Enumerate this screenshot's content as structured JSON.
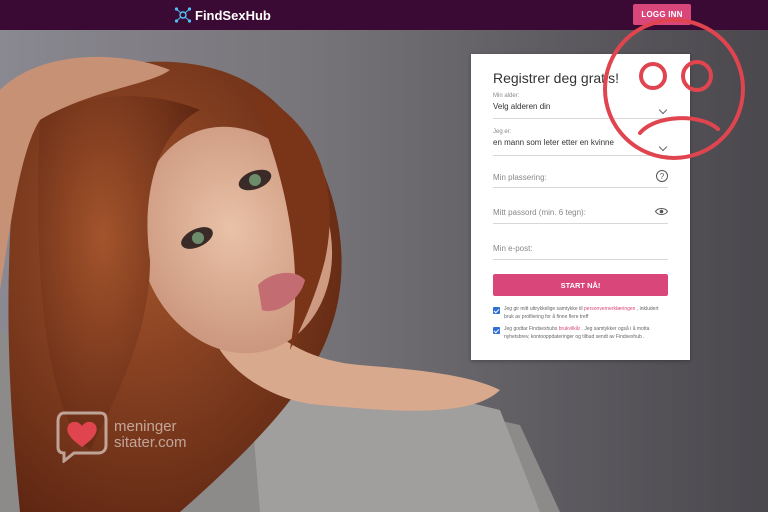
{
  "header": {
    "logo_text": "FindSexHub",
    "logo_icon": "network-icon",
    "login_label": "LOGG INN"
  },
  "form": {
    "title": "Registrer deg gratis!",
    "age": {
      "label": "Min alder:",
      "value": "Velg alderen din"
    },
    "gender": {
      "label": "Jeg er:",
      "value": "en mann som leter etter en kvinne"
    },
    "location_placeholder": "Min plassering:",
    "password_placeholder": "Mitt passord (min. 6 tegn):",
    "email_placeholder": "Min e-post:",
    "submit_label": "START NÅ!",
    "consent1": {
      "text_a": "Jeg gir mitt uttrykkelige samtykke til ",
      "link": "personvernerklæringen",
      "text_b": " , inkludert bruk av profilering for å finne flere treff"
    },
    "consent2": {
      "text_a": "Jeg godtar Findsexhubs ",
      "link": "brukvilkår",
      "text_b": " . Jeg samtykker også i å motta nyhetsbrev, kontooppdateringer og tilbud sendt av Findsexhub ."
    }
  },
  "watermark": {
    "line1": "meninger",
    "line2": "sitater.com"
  },
  "colors": {
    "topbar": "#3a0a34",
    "accent": "#d9467a",
    "sad_face": "#e0454f",
    "checkbox": "#2f6fd6"
  }
}
